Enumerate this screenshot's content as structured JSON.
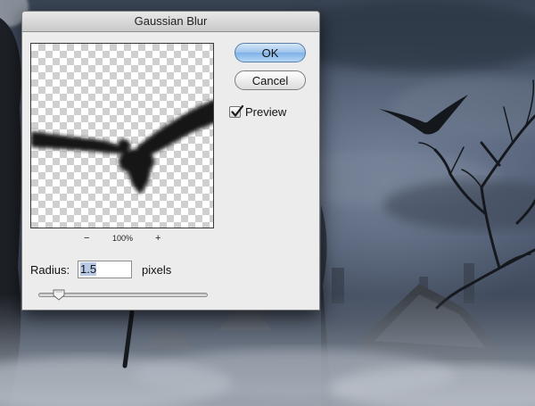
{
  "dialog": {
    "title": "Gaussian Blur",
    "ok_label": "OK",
    "cancel_label": "Cancel",
    "preview_label": "Preview",
    "preview_checked": true,
    "zoom": {
      "minus_label": "−",
      "level": "100%",
      "plus_label": "+"
    },
    "radius": {
      "label": "Radius:",
      "value": "1.5",
      "unit": "pixels",
      "slider_fraction": 0.08
    }
  },
  "colors": {
    "dialog_bg": "#ececec",
    "ok_button_accent": "#7eb1e6"
  },
  "icons": [
    "checkmark-icon",
    "slider-thumb-icon",
    "bird-silhouette"
  ]
}
